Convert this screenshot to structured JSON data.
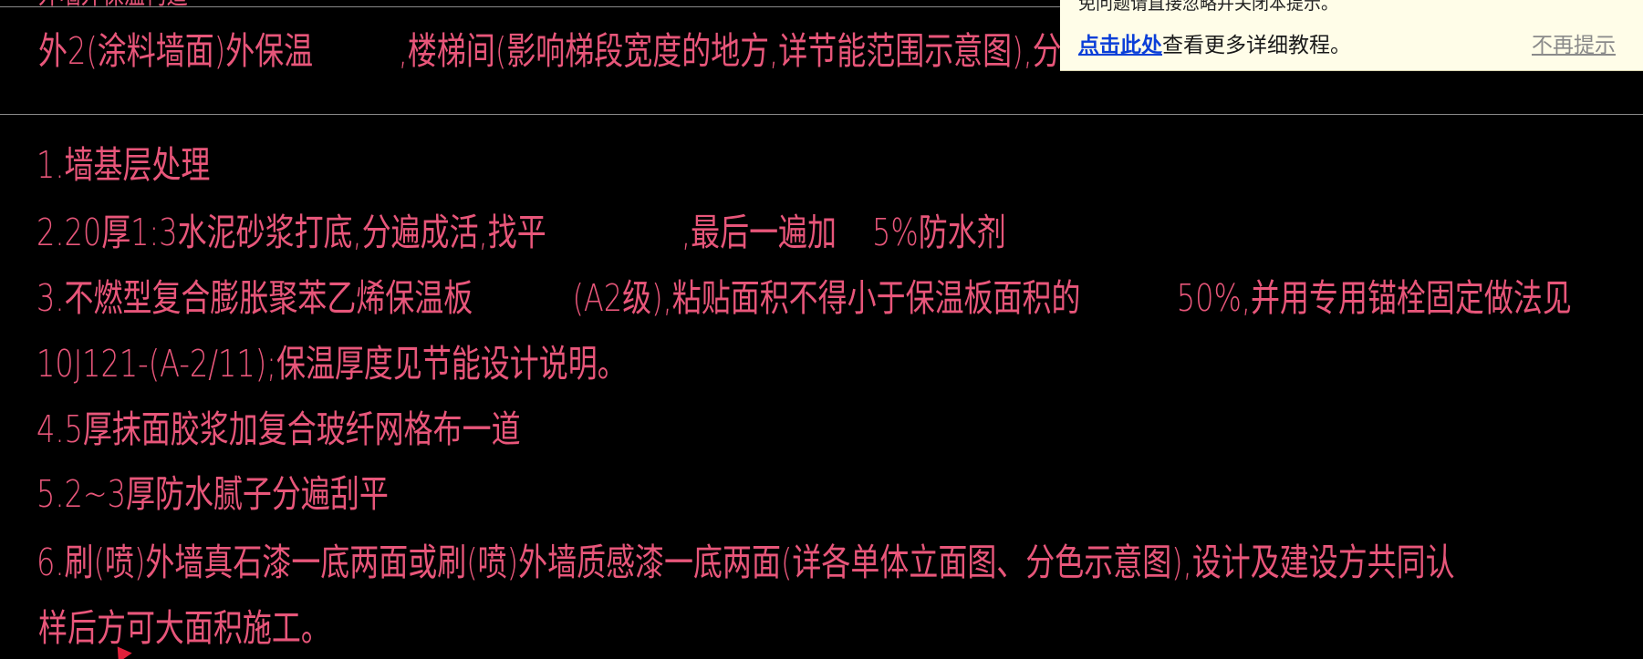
{
  "canvas": {
    "top_partial": "外墙外保温构造",
    "header_line": {
      "part1": "外2(涂料墙面)外保温",
      "part2": ",楼梯间(影响梯段宽度的地方,详节能范围示意图),分户墙等内墙保温详说明第"
    },
    "lines": [
      {
        "id": "l1",
        "text": "1.墙基层处理"
      },
      {
        "id": "l2",
        "a": "2.20厚1:3水泥砂浆打底,分遍成活,找平",
        "b": ",最后一遍加",
        "c": "5%防水剂"
      },
      {
        "id": "l3",
        "a": "3.不燃型复合膨胀聚苯乙烯保温板",
        "b": "(A2级),粘贴面积不得小于保温板面积的",
        "c": "50%,并用专用锚栓固定做法见"
      },
      {
        "id": "l4",
        "a": "10J121-(A-2/11);",
        "b": "保温厚度见节能设计说明。"
      },
      {
        "id": "l5",
        "text": "4.5厚抹面胶浆加复合玻纤网格布一道"
      },
      {
        "id": "l6",
        "text": "5.2~3厚防水腻子分遍刮平"
      },
      {
        "id": "l7",
        "text": "6.刷(喷)外墙真石漆一底两面或刷(喷)外墙质感漆一底两面(详各单体立面图、分色示意图),设计及建设方共同认"
      },
      {
        "id": "l8",
        "text": "样后方可大面积施工。"
      }
    ]
  },
  "notification": {
    "cut_text": "免问题请直接忽略并关闭本提示。",
    "link": "点击此处",
    "message": "查看更多详细教程。",
    "dismiss": "不再提示"
  },
  "colors": {
    "background": "#000000",
    "cad_text": "#e8567a",
    "notify_bg": "#fffde8",
    "link": "#0b3fd8"
  }
}
